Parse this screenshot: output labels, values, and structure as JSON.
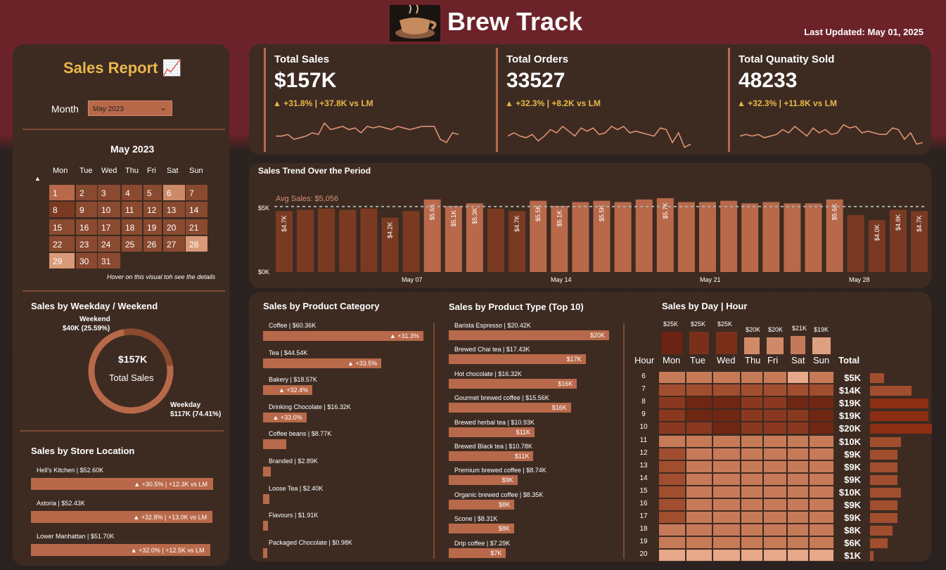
{
  "header": {
    "title": "Brew Track",
    "last_updated": "Last Updated: May 01, 2025",
    "logo_icon": "coffee-cup-logo"
  },
  "sidebar": {
    "report_title": "Sales Report 📈",
    "month_label": "Month",
    "month_value": "May 2023",
    "calendar_title": "May 2023",
    "weekdays": [
      "Mon",
      "Tue",
      "Wed",
      "Thu",
      "Fri",
      "Sat",
      "Sun"
    ],
    "hover_note": "Hover on this visual toh see the details"
  },
  "weekday_chart": {
    "title": "Sales by Weekday / Weekend",
    "center_value": "$157K",
    "center_label": "Total Sales",
    "weekend_label": "Weekend",
    "weekend_value": "$40K (25.59%)",
    "weekday_label": "Weekday",
    "weekday_value": "$117K (74.41%)",
    "weekend_share": 25.59
  },
  "store_chart": {
    "title": "Sales by Store Location",
    "stores": [
      {
        "label": "Hell's Kitchen | $52.60K",
        "delta": "▲ +30.5% | +12.3K vs LM",
        "value": 52.6
      },
      {
        "label": "Astoria | $52.43K",
        "delta": "▲ +32.8% | +13.0K vs LM",
        "value": 52.43
      },
      {
        "label": "Lower Manhattan | $51.70K",
        "delta": "▲ +32.0% | +12.5K vs LM",
        "value": 51.7
      }
    ]
  },
  "kpis": [
    {
      "title": "Total Sales",
      "value": "$157K",
      "delta": "▲ +31.8% | +37.8K vs LM"
    },
    {
      "title": "Total Orders",
      "value": "33527",
      "delta": "▲ +32.3% | +8.2K vs LM"
    },
    {
      "title": "Total Qunatity Sold",
      "value": "48233",
      "delta": "▲ +32.3% | +11.8K vs LM"
    }
  ],
  "trend": {
    "title": "Sales Trend Over the Period",
    "avg_label": "Avg Sales: $5,056",
    "y_ticks": [
      "$5K",
      "$0K"
    ],
    "x_ticks": [
      "May 07",
      "May 14",
      "May 21",
      "May 28"
    ]
  },
  "category_chart": {
    "title": "Sales by Product Category",
    "items": [
      {
        "label": "Coffee | $60.36K",
        "delta": "▲ +31.3%",
        "value": 60.36
      },
      {
        "label": "Tea | $44.54K",
        "delta": "▲ +33.5%",
        "value": 44.54
      },
      {
        "label": "Bakery | $18.57K",
        "delta": "▲ +32.4%",
        "value": 18.57
      },
      {
        "label": "Drinking Chocolate | $16.32K",
        "delta": "▲ +33.0%",
        "value": 16.32
      },
      {
        "label": "Coffee beans | $8.77K",
        "delta": "",
        "value": 8.77
      },
      {
        "label": "Branded | $2.89K",
        "delta": "",
        "value": 2.89
      },
      {
        "label": "Loose Tea | $2.40K",
        "delta": "",
        "value": 2.4
      },
      {
        "label": "Flavours | $1.91K",
        "delta": "",
        "value": 1.91
      },
      {
        "label": "Packaged Chocolate | $0.98K",
        "delta": "",
        "value": 0.98
      }
    ]
  },
  "type_chart": {
    "title": "Sales by Product Type (Top 10)",
    "items": [
      {
        "label": "Barista Espresso | $20.42K",
        "bar": "$20K",
        "value": 20.42
      },
      {
        "label": "Brewed Chai tea | $17.43K",
        "bar": "$17K",
        "value": 17.43
      },
      {
        "label": "Hot chocolate | $16.32K",
        "bar": "$16K",
        "value": 16.32
      },
      {
        "label": "Gourmet brewed coffee | $15.56K",
        "bar": "$16K",
        "value": 15.56
      },
      {
        "label": "Brewed herbal tea | $10.93K",
        "bar": "$11K",
        "value": 10.93
      },
      {
        "label": "Brewed Black tea | $10.78K",
        "bar": "$11K",
        "value": 10.78
      },
      {
        "label": "Premium brewed coffee | $8.74K",
        "bar": "$9K",
        "value": 8.74
      },
      {
        "label": "Organic brewed coffee | $8.35K",
        "bar": "$8K",
        "value": 8.35
      },
      {
        "label": "Scone | $8.31K",
        "bar": "$8K",
        "value": 8.31
      },
      {
        "label": "Drip coffee | $7.29K",
        "bar": "$7K",
        "value": 7.29
      }
    ]
  },
  "heatmap": {
    "title": "Sales by Day | Hour",
    "hour_label": "Hour",
    "total_label": "Total",
    "days": [
      "Mon",
      "Tue",
      "Wed",
      "Thu",
      "Fri",
      "Sat",
      "Sun"
    ],
    "day_totals": [
      "$25K",
      "$25K",
      "$25K",
      "$20K",
      "$20K",
      "$21K",
      "$19K"
    ],
    "hours": [
      "6",
      "7",
      "8",
      "9",
      "10",
      "11",
      "12",
      "13",
      "14",
      "15",
      "16",
      "17",
      "18",
      "19",
      "20"
    ],
    "hour_totals": [
      "$5K",
      "$14K",
      "$19K",
      "$19K",
      "$20K",
      "$10K",
      "$9K",
      "$9K",
      "$9K",
      "$10K",
      "$9K",
      "$9K",
      "$8K",
      "$6K",
      "$1K"
    ]
  },
  "chart_data": {
    "type": "bar",
    "title": "Sales Trend Over the Period",
    "x": [
      1,
      2,
      3,
      4,
      5,
      6,
      7,
      8,
      9,
      10,
      11,
      12,
      13,
      14,
      15,
      16,
      17,
      18,
      19,
      20,
      21,
      22,
      23,
      24,
      25,
      26,
      27,
      28,
      29,
      30,
      31
    ],
    "values": [
      4.7,
      4.8,
      4.9,
      4.8,
      4.9,
      4.2,
      4.7,
      5.6,
      5.1,
      5.3,
      4.9,
      4.7,
      5.5,
      5.1,
      5.4,
      5.5,
      5.4,
      5.6,
      5.7,
      5.4,
      5.4,
      5.5,
      5.3,
      5.4,
      5.3,
      5.3,
      5.6,
      4.4,
      4.0,
      4.8,
      4.7
    ],
    "data_labels": {
      "1": "$4.7K",
      "6": "$4.2K",
      "8": "$5.6K",
      "9": "$5.1K",
      "10": "$5.3K",
      "12": "$4.7K",
      "13": "$5.5K",
      "14": "$5.1K",
      "16": "$5.5K",
      "19": "$5.7K",
      "27": "$5.6K",
      "29": "$4.0K",
      "30": "$4.8K",
      "31": "$4.7K"
    },
    "avg": 5.056,
    "ylim": [
      0,
      6
    ],
    "bar_color": "#b8694a",
    "low_color": "#7a3a22"
  }
}
